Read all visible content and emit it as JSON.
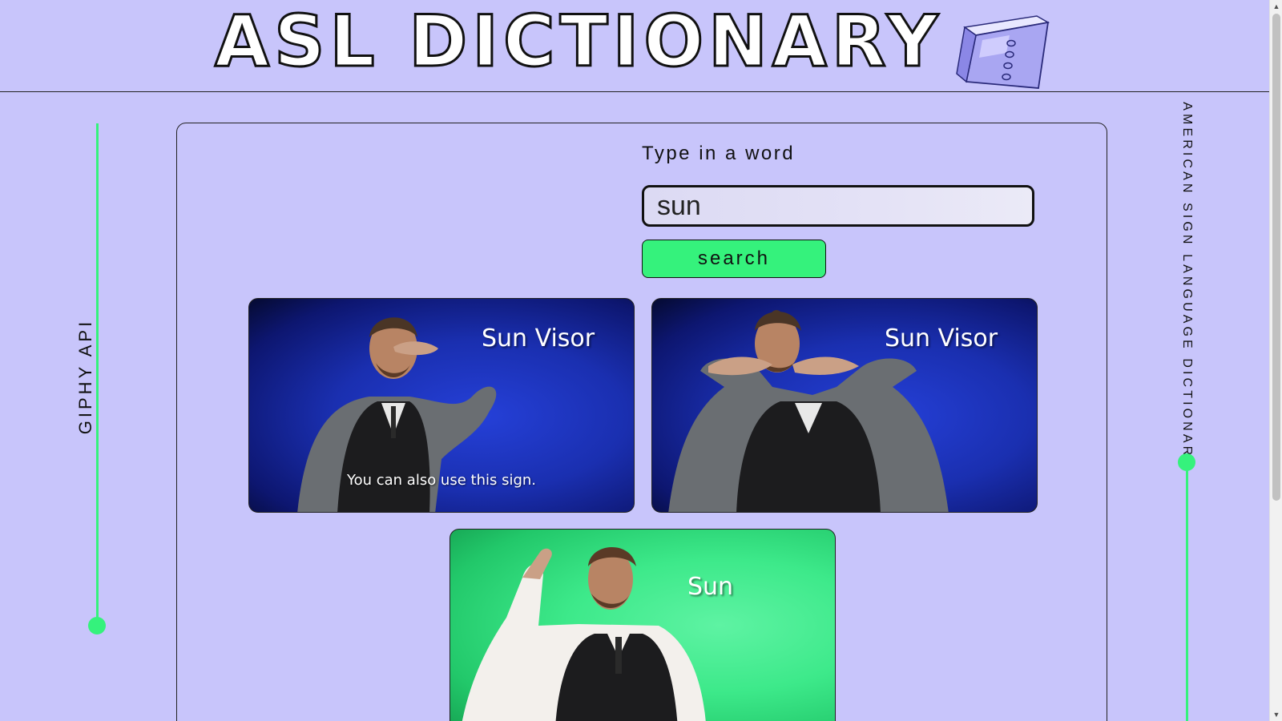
{
  "header": {
    "title": "ASL DICTIONARY",
    "logo_icon": "book-icon"
  },
  "left_rail": {
    "label": "GIPHY API"
  },
  "right_rail": {
    "label": "AMERICAN SIGN LANGUAGE DICTIONARY"
  },
  "search": {
    "prompt": "Type in a word",
    "value": "sun",
    "button_label": "search"
  },
  "results": [
    {
      "caption": "Sun Visor",
      "subtitle": "You can also use this sign.",
      "background": "blue"
    },
    {
      "caption": "Sun Visor",
      "subtitle": "",
      "background": "blue"
    },
    {
      "caption": "Sun",
      "subtitle": "",
      "background": "green"
    }
  ],
  "colors": {
    "background": "#c8c5fb",
    "accent": "#35f27c",
    "outline": "#111111"
  }
}
